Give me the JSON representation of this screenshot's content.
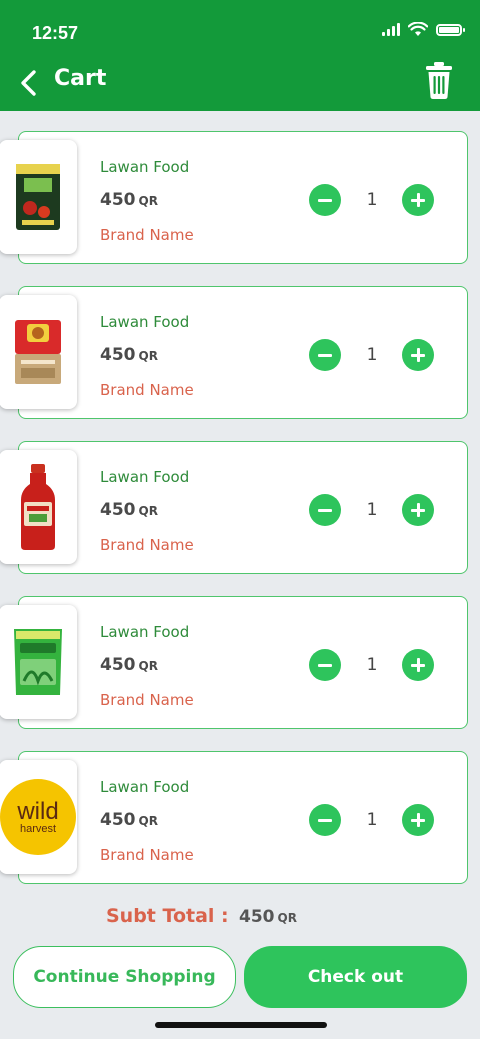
{
  "status_bar": {
    "time": "12:57"
  },
  "header": {
    "title": "Cart"
  },
  "cart": {
    "items": [
      {
        "name": "Lawan Food",
        "price": "450",
        "currency": "QR",
        "brand": "Brand Name",
        "quantity": "1",
        "image": "rice-bag-product-image"
      },
      {
        "name": "Lawan Food",
        "price": "450",
        "currency": "QR",
        "brand": "Brand Name",
        "quantity": "1",
        "image": "snack-pack-product-image"
      },
      {
        "name": "Lawan Food",
        "price": "450",
        "currency": "QR",
        "brand": "Brand Name",
        "quantity": "1",
        "image": "juice-bottle-product-image"
      },
      {
        "name": "Lawan Food",
        "price": "450",
        "currency": "QR",
        "brand": "Brand Name",
        "quantity": "1",
        "image": "green-bag-product-image"
      },
      {
        "name": "Lawan Food",
        "price": "450",
        "currency": "QR",
        "brand": "Brand Name",
        "quantity": "1",
        "image": "wild-harvest-logo-image",
        "logo_text": [
          "wild",
          "harvest"
        ]
      }
    ]
  },
  "summary": {
    "subtotal_label": "Subt Total :",
    "subtotal_value": "450",
    "currency": "QR"
  },
  "actions": {
    "continue_label": "Continue Shopping",
    "checkout_label": "Check out"
  },
  "colors": {
    "primary": "#139a3a",
    "accent": "#2ec45c",
    "brand_text": "#d9634c"
  }
}
